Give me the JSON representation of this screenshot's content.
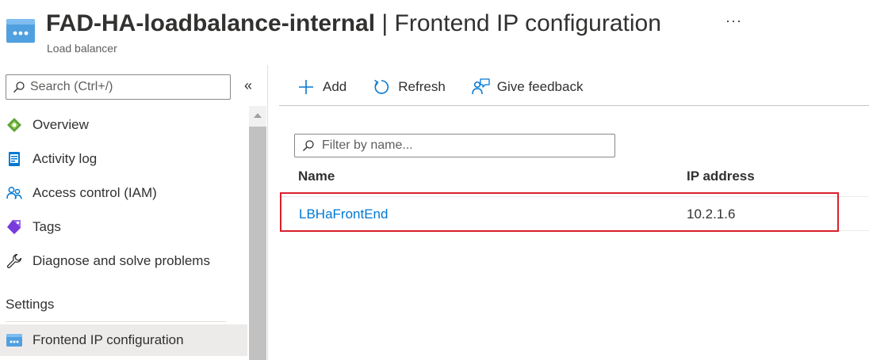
{
  "header": {
    "resource_name": "FAD-HA-loadbalance-internal",
    "separator": "|",
    "blade_title": "Frontend IP configuration",
    "resource_type": "Load balancer",
    "more_label": "···"
  },
  "sidebar": {
    "search_placeholder": "Search (Ctrl+/)",
    "collapse_label": "«",
    "items": [
      {
        "label": "Overview",
        "icon": "overview-icon"
      },
      {
        "label": "Activity log",
        "icon": "activity-log-icon"
      },
      {
        "label": "Access control (IAM)",
        "icon": "iam-icon"
      },
      {
        "label": "Tags",
        "icon": "tag-icon"
      },
      {
        "label": "Diagnose and solve problems",
        "icon": "wrench-icon"
      }
    ],
    "section_settings": "Settings",
    "settings_items": [
      {
        "label": "Frontend IP configuration",
        "icon": "frontend-ip-icon",
        "active": true
      }
    ]
  },
  "toolbar": {
    "add_label": "Add",
    "refresh_label": "Refresh",
    "feedback_label": "Give feedback"
  },
  "filter": {
    "placeholder": "Filter by name..."
  },
  "table": {
    "columns": [
      "Name",
      "IP address"
    ],
    "rows": [
      {
        "name": "LBHaFrontEnd",
        "ip": "10.2.1.6"
      }
    ]
  },
  "colors": {
    "accent": "#0078d4",
    "highlight": "#d9202c",
    "text": "#323130"
  }
}
